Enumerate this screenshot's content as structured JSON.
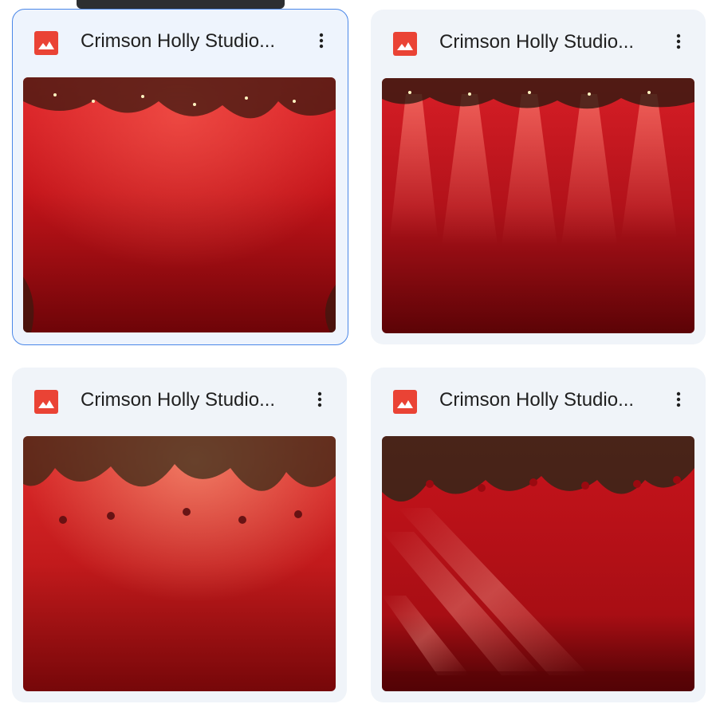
{
  "files": [
    {
      "title": "Crimson Holly Studio...",
      "icon": "image-file-icon",
      "menu_icon": "more-vert-icon",
      "selected": true
    },
    {
      "title": "Crimson Holly Studio...",
      "icon": "image-file-icon",
      "menu_icon": "more-vert-icon",
      "selected": false
    },
    {
      "title": "Crimson Holly Studio...",
      "icon": "image-file-icon",
      "menu_icon": "more-vert-icon",
      "selected": false
    },
    {
      "title": "Crimson Holly Studio...",
      "icon": "image-file-icon",
      "menu_icon": "more-vert-icon",
      "selected": false
    }
  ],
  "colors": {
    "image_icon": "#ea4335",
    "card_bg": "#f0f4f9",
    "selected_border": "#4a87e8",
    "backdrop_red": "#c8141c"
  }
}
